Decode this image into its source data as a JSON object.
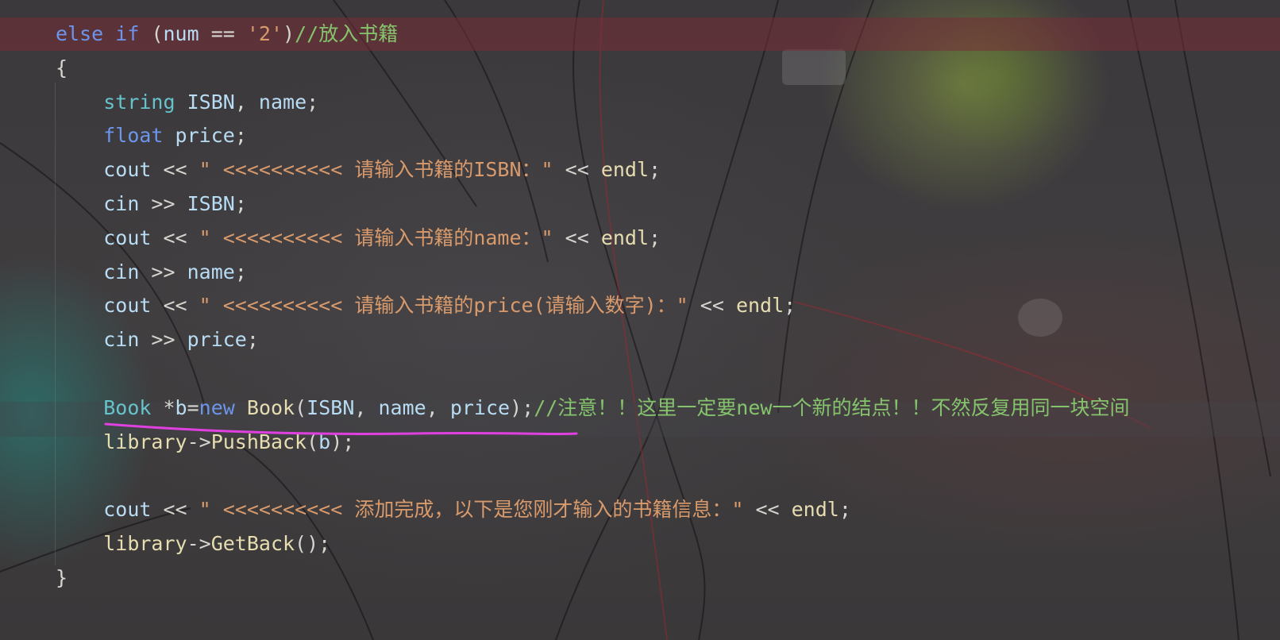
{
  "editor": {
    "lines": [
      {
        "tokens": [
          {
            "t": "else",
            "c": "kw"
          },
          {
            "t": " "
          },
          {
            "t": "if",
            "c": "kw"
          },
          {
            "t": " ("
          },
          {
            "t": "num",
            "c": "ident"
          },
          {
            "t": " == "
          },
          {
            "t": "'2'",
            "c": "str"
          },
          {
            "t": ")"
          },
          {
            "t": "//放入书籍",
            "c": "cmt"
          }
        ]
      },
      {
        "tokens": [
          {
            "t": "{"
          }
        ]
      },
      {
        "tokens": [
          {
            "t": "    "
          },
          {
            "t": "string",
            "c": "type"
          },
          {
            "t": " "
          },
          {
            "t": "ISBN",
            "c": "ident"
          },
          {
            "t": ", "
          },
          {
            "t": "name",
            "c": "ident"
          },
          {
            "t": ";"
          }
        ]
      },
      {
        "tokens": [
          {
            "t": "    "
          },
          {
            "t": "float",
            "c": "kw"
          },
          {
            "t": " "
          },
          {
            "t": "price",
            "c": "ident"
          },
          {
            "t": ";"
          }
        ]
      },
      {
        "tokens": [
          {
            "t": "    "
          },
          {
            "t": "cout",
            "c": "ident"
          },
          {
            "t": " << "
          },
          {
            "t": "\" <<<<<<<<<< 请输入书籍的ISBN：\"",
            "c": "str"
          },
          {
            "t": " << "
          },
          {
            "t": "endl",
            "c": "func"
          },
          {
            "t": ";"
          }
        ]
      },
      {
        "tokens": [
          {
            "t": "    "
          },
          {
            "t": "cin",
            "c": "ident"
          },
          {
            "t": " >> "
          },
          {
            "t": "ISBN",
            "c": "ident"
          },
          {
            "t": ";"
          }
        ]
      },
      {
        "tokens": [
          {
            "t": "    "
          },
          {
            "t": "cout",
            "c": "ident"
          },
          {
            "t": " << "
          },
          {
            "t": "\" <<<<<<<<<< 请输入书籍的name：\"",
            "c": "str"
          },
          {
            "t": " << "
          },
          {
            "t": "endl",
            "c": "func"
          },
          {
            "t": ";"
          }
        ]
      },
      {
        "tokens": [
          {
            "t": "    "
          },
          {
            "t": "cin",
            "c": "ident"
          },
          {
            "t": " >> "
          },
          {
            "t": "name",
            "c": "ident"
          },
          {
            "t": ";"
          }
        ]
      },
      {
        "tokens": [
          {
            "t": "    "
          },
          {
            "t": "cout",
            "c": "ident"
          },
          {
            "t": " << "
          },
          {
            "t": "\" <<<<<<<<<< 请输入书籍的price(请输入数字)：\"",
            "c": "str"
          },
          {
            "t": " << "
          },
          {
            "t": "endl",
            "c": "func"
          },
          {
            "t": ";"
          }
        ]
      },
      {
        "tokens": [
          {
            "t": "    "
          },
          {
            "t": "cin",
            "c": "ident"
          },
          {
            "t": " >> "
          },
          {
            "t": "price",
            "c": "ident"
          },
          {
            "t": ";"
          }
        ]
      },
      {
        "tokens": []
      },
      {
        "tokens": [
          {
            "t": "    "
          },
          {
            "t": "Book",
            "c": "type"
          },
          {
            "t": " *"
          },
          {
            "t": "b",
            "c": "ident"
          },
          {
            "t": "="
          },
          {
            "t": "new",
            "c": "kw"
          },
          {
            "t": " "
          },
          {
            "t": "Book",
            "c": "func"
          },
          {
            "t": "("
          },
          {
            "t": "ISBN",
            "c": "ident"
          },
          {
            "t": ", "
          },
          {
            "t": "name",
            "c": "ident"
          },
          {
            "t": ", "
          },
          {
            "t": "price",
            "c": "ident"
          },
          {
            "t": ");"
          },
          {
            "t": "//注意！！这里一定要new一个新的结点！！不然反复用同一块空间",
            "c": "cmt"
          }
        ]
      },
      {
        "tokens": [
          {
            "t": "    "
          },
          {
            "t": "library",
            "c": "func"
          },
          {
            "t": "->"
          },
          {
            "t": "PushBack",
            "c": "func"
          },
          {
            "t": "("
          },
          {
            "t": "b",
            "c": "ident"
          },
          {
            "t": ");"
          }
        ]
      },
      {
        "tokens": []
      },
      {
        "tokens": [
          {
            "t": "    "
          },
          {
            "t": "cout",
            "c": "ident"
          },
          {
            "t": " << "
          },
          {
            "t": "\" <<<<<<<<<< 添加完成，以下是您刚才输入的书籍信息：\"",
            "c": "str"
          },
          {
            "t": " << "
          },
          {
            "t": "endl",
            "c": "func"
          },
          {
            "t": ";"
          }
        ]
      },
      {
        "tokens": [
          {
            "t": "    "
          },
          {
            "t": "library",
            "c": "func"
          },
          {
            "t": "->"
          },
          {
            "t": "GetBack",
            "c": "func"
          },
          {
            "t": "();"
          }
        ]
      },
      {
        "tokens": [
          {
            "t": "}"
          }
        ]
      }
    ]
  },
  "colors": {
    "keyword": "#6c95eb",
    "type": "#66c3cc",
    "identifier": "#b8dcf4",
    "string": "#d99a6c",
    "comment": "#85c46c",
    "function": "#e6ddb0",
    "annotation_underline": "#e040e0",
    "highlighted_line": "#782d37"
  }
}
